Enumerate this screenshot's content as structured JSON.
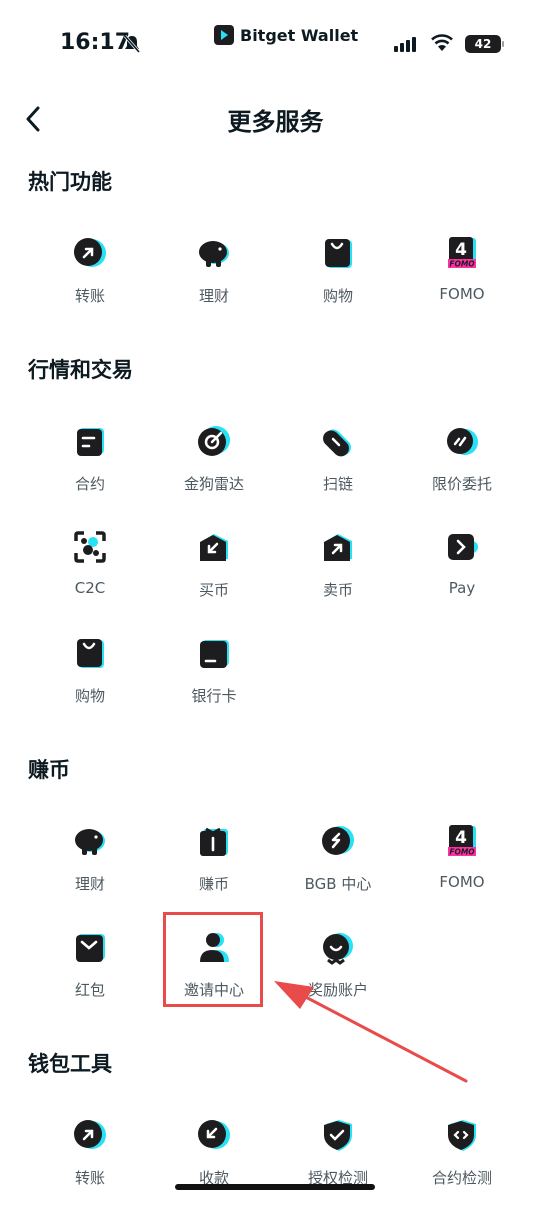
{
  "status": {
    "time": "16:17",
    "battery": "42"
  },
  "brand": {
    "name": "Bitget Wallet"
  },
  "nav": {
    "title": "更多服务"
  },
  "sections": [
    {
      "title": "热门功能",
      "items": [
        "转账",
        "理财",
        "购物",
        "FOMO"
      ]
    },
    {
      "title": "行情和交易",
      "items": [
        "合约",
        "金狗雷达",
        "扫链",
        "限价委托",
        "C2C",
        "买币",
        "卖币",
        "Pay",
        "购物",
        "银行卡"
      ]
    },
    {
      "title": "赚币",
      "items": [
        "理财",
        "赚币",
        "BGB 中心",
        "FOMO",
        "红包",
        "邀请中心",
        "奖励账户"
      ]
    },
    {
      "title": "钱包工具",
      "items": [
        "转账",
        "收款",
        "授权检测",
        "合约检测"
      ]
    }
  ],
  "fomo_badge": {
    "number": "4",
    "text": "FOMO"
  },
  "colors": {
    "accent": "#27e1f5",
    "icon": "#1d1d1f",
    "highlight": "#e94b4b",
    "fomo_pink": "#ff2fa6"
  }
}
